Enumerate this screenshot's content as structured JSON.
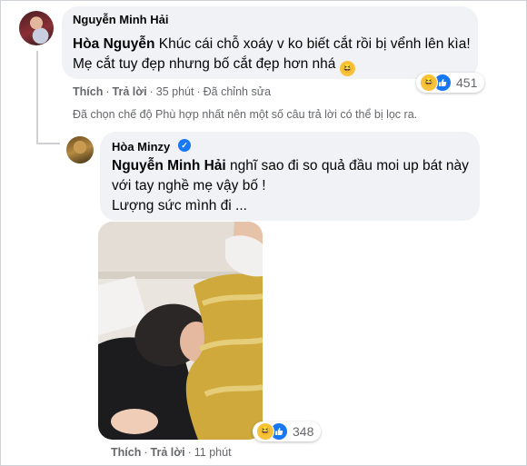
{
  "comment": {
    "author": "Nguyễn Minh Hải",
    "mention": "Hòa Nguyễn",
    "text_after_mention": " Khúc cái chỗ xoáy v ko biết cắt rồi bị vểnh lên kìa! Mẹ cắt tuy đẹp nhưng bố cắt đẹp hơn nhá",
    "reaction_icons": [
      "haha-icon",
      "like-icon"
    ],
    "reaction_count": "451",
    "actions": {
      "like": "Thích",
      "reply": "Trả lời",
      "time": "35 phút",
      "edited": "Đã chỉnh sửa"
    }
  },
  "filter_notice": "Đã chọn chế độ Phù hợp nhất nên một số câu trả lời có thể bị lọc ra.",
  "reply": {
    "author": "Hòa Minzy",
    "verified": true,
    "mention": "Nguyễn Minh Hải",
    "text_after_mention": " nghĩ sao đi so quả đầu moi up bát này với tay nghề mẹ vậy bố !",
    "second_line": "Lượng sức mình đi ...",
    "reaction_icons": [
      "haha-icon",
      "like-icon"
    ],
    "reaction_count": "348",
    "actions": {
      "like": "Thích",
      "reply": "Trả lời",
      "time": "11 phút"
    }
  },
  "colors": {
    "bubble": "#f0f2f5",
    "meta_text": "#65676b",
    "like_blue": "#1877f2",
    "haha_yellow": "#f7c23c"
  }
}
